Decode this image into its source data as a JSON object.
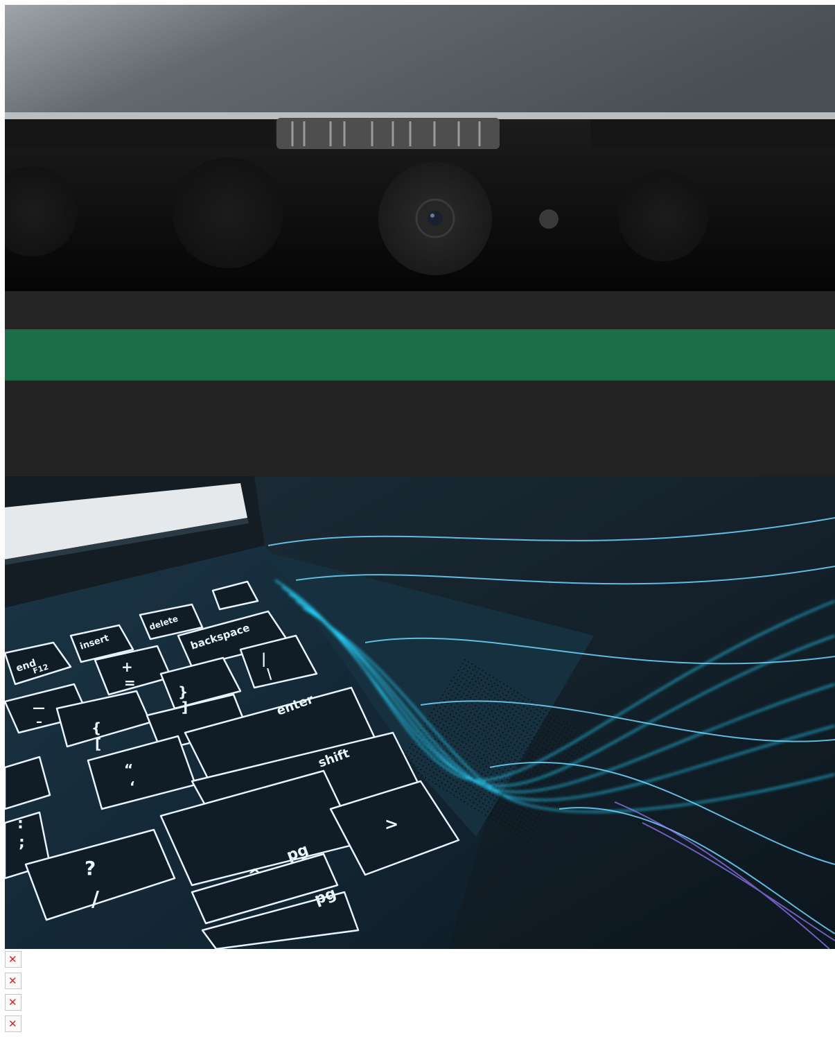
{
  "images": [
    {
      "id": "webcam",
      "kind": "photo"
    },
    {
      "id": "keyboard",
      "kind": "photo",
      "keycaps": {
        "end": "end",
        "f12": "F12",
        "insert": "insert",
        "delete": "delete",
        "backspace": "backspace",
        "plus": "+",
        "equals": "=",
        "minus": "—",
        "minus2": "–",
        "brace_open": "{",
        "bracket_open": "[",
        "brace_close": "}",
        "bracket_close": "]",
        "pipe": "|",
        "backslash": "\\",
        "enter": "enter",
        "shift": "shift",
        "quote": "“",
        "apos": "‘",
        "colon": ":",
        "semicolon": ";",
        "question": "?",
        "slash": "/",
        "pg": "pg",
        "up": "^",
        "right": ">"
      }
    }
  ],
  "broken_images": [
    {
      "icon": "broken-image-icon"
    },
    {
      "icon": "broken-image-icon"
    },
    {
      "icon": "broken-image-icon"
    },
    {
      "icon": "broken-image-icon"
    }
  ],
  "colors": {
    "accent_green": "#1c6e48",
    "glow_cyan": "#28d6ff"
  }
}
